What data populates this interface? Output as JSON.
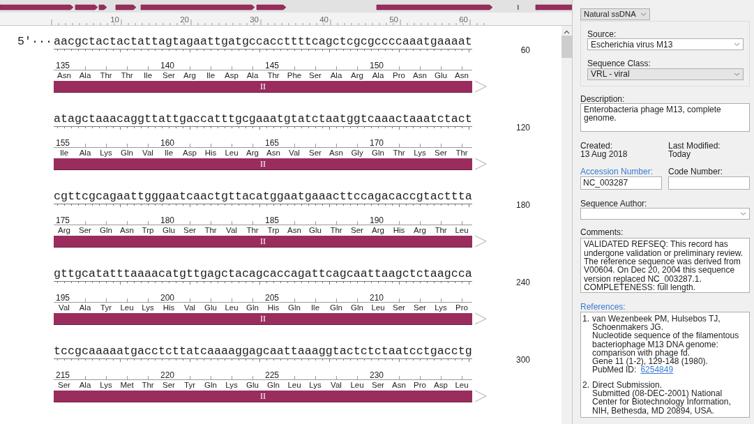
{
  "overview": {
    "ruler_labels": [
      "10",
      "20",
      "30",
      "40",
      "50",
      "60"
    ]
  },
  "sequence_rows": [
    {
      "prefix": "5′···",
      "sequence": "aacgctactactattagtagaattgatgccaccttttcagctcgcgccccaaatgaaaat",
      "end": "60",
      "residue_numbers": [
        "135",
        "140",
        "145",
        "150"
      ],
      "amino_acids": [
        "Asn",
        "Ala",
        "Thr",
        "Thr",
        "Ile",
        "Ser",
        "Arg",
        "Ile",
        "Asp",
        "Ala",
        "Thr",
        "Phe",
        "Ser",
        "Ala",
        "Arg",
        "Ala",
        "Pro",
        "Asn",
        "Glu",
        "Asn"
      ],
      "feature": "II"
    },
    {
      "sequence": "atagctaaacaggttattgaccatttgcgaaatgtatctaatggtcaaactaaatctact",
      "end": "120",
      "residue_numbers": [
        "155",
        "160",
        "165",
        "170"
      ],
      "amino_acids": [
        "Ile",
        "Ala",
        "Lys",
        "Gln",
        "Val",
        "Ile",
        "Asp",
        "His",
        "Leu",
        "Arg",
        "Asn",
        "Val",
        "Ser",
        "Asn",
        "Gly",
        "Gln",
        "Thr",
        "Lys",
        "Ser",
        "Thr"
      ],
      "feature": "II"
    },
    {
      "sequence": "cgttcgcagaattgggaatcaactgttacatggaatgaaacttccagacaccgtacttta",
      "end": "180",
      "residue_numbers": [
        "175",
        "180",
        "185",
        "190"
      ],
      "amino_acids": [
        "Arg",
        "Ser",
        "Gln",
        "Asn",
        "Trp",
        "Glu",
        "Ser",
        "Thr",
        "Val",
        "Thr",
        "Trp",
        "Asn",
        "Glu",
        "Thr",
        "Ser",
        "Arg",
        "His",
        "Arg",
        "Thr",
        "Leu"
      ],
      "feature": "II"
    },
    {
      "sequence": "gttgcatatttaaaacatgttgagctacagcaccagattcagcaattaagctctaagcca",
      "end": "240",
      "residue_numbers": [
        "195",
        "200",
        "205",
        "210"
      ],
      "amino_acids": [
        "Val",
        "Ala",
        "Tyr",
        "Leu",
        "Lys",
        "His",
        "Val",
        "Glu",
        "Leu",
        "Gln",
        "His",
        "Gln",
        "Ile",
        "Gln",
        "Gln",
        "Leu",
        "Ser",
        "Ser",
        "Lys",
        "Pro"
      ],
      "feature": "II"
    },
    {
      "sequence": "tccgcaaaaatgacctcttatcaaaaggagcaattaaaggtactctctaatcctgacctg",
      "end": "300",
      "residue_numbers": [
        "215",
        "220",
        "225",
        "230"
      ],
      "amino_acids": [
        "Ser",
        "Ala",
        "Lys",
        "Met",
        "Thr",
        "Ser",
        "Tyr",
        "Gln",
        "Lys",
        "Glu",
        "Gln",
        "Leu",
        "Lys",
        "Val",
        "Leu",
        "Ser",
        "Asn",
        "Pro",
        "Asp",
        "Leu"
      ],
      "feature": "II"
    }
  ],
  "properties": {
    "molecule_type": "Natural ssDNA",
    "source": {
      "label": "Source:",
      "value": "Escherichia virus M13",
      "disabled": false
    },
    "sequence_class": {
      "label": "Sequence Class:",
      "value": "VRL - viral",
      "disabled": true
    },
    "description": {
      "label": "Description:",
      "value": "Enterobacteria phage M13, complete genome."
    },
    "created": {
      "label": "Created:",
      "value": "13 Aug 2018"
    },
    "last_modified": {
      "label": "Last Modified:",
      "value": "Today"
    },
    "accession_number": {
      "label": "Accession Number:",
      "value": "NC_003287",
      "link": true
    },
    "code_number": {
      "label": "Code Number:",
      "link": false
    },
    "sequence_author": {
      "label": "Sequence Author:"
    },
    "comments": {
      "label": "Comments:",
      "value": "VALIDATED REFSEQ: This record has undergone validation or preliminary review. The reference sequence was derived from V00604. On Dec 20, 2004 this sequence version replaced NC_003287.1. COMPLETENESS: full length."
    },
    "references": {
      "label": "References:",
      "link": true,
      "items": [
        {
          "number": "1.",
          "authors": "van Wezenbeek PM, Hulsebos TJ, Schoenmakers JG.",
          "title": "Nucleotide sequence of the filamentous bacteriophage M13 DNA genome: comparison with phage fd.",
          "journal": "Gene 11 (1-2), 129-148 (1980).",
          "pubmed_label": "PubMed ID:",
          "pubmed_id": "6254849"
        },
        {
          "number": "2.",
          "title": "Direct Submission.",
          "journal": "Submitted (08-DEC-2001) National Center for Biotechnology Information, NIH, Bethesda, MD 20894, USA."
        }
      ]
    }
  }
}
